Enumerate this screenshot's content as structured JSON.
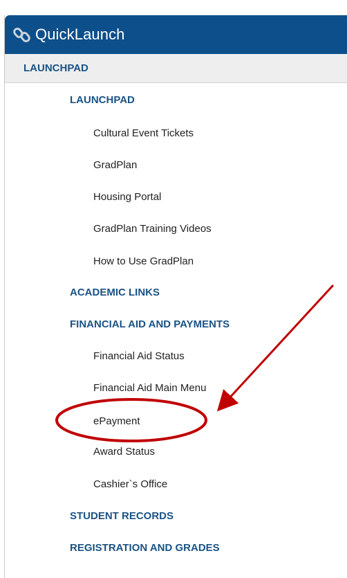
{
  "header": {
    "title": "QuickLaunch",
    "icon": "link-chain-icon",
    "bg_color": "#0d4f8b"
  },
  "section": {
    "label": "LAUNCHPAD"
  },
  "menu": [
    {
      "type": "category",
      "label": "LAUNCHPAD"
    },
    {
      "type": "item",
      "label": "Cultural Event Tickets"
    },
    {
      "type": "item",
      "label": "GradPlan"
    },
    {
      "type": "item",
      "label": "Housing Portal"
    },
    {
      "type": "item",
      "label": "GradPlan Training Videos"
    },
    {
      "type": "item",
      "label": "How to Use GradPlan"
    },
    {
      "type": "category",
      "label": "ACADEMIC LINKS"
    },
    {
      "type": "category",
      "label": "FINANCIAL AID AND PAYMENTS"
    },
    {
      "type": "item",
      "label": "Financial Aid Status"
    },
    {
      "type": "item",
      "label": "Financial Aid Main Menu"
    },
    {
      "type": "item",
      "label": "ePayment"
    },
    {
      "type": "item",
      "label": "Award Status"
    },
    {
      "type": "item",
      "label": "Cashier`s Office"
    },
    {
      "type": "category",
      "label": "STUDENT RECORDS"
    },
    {
      "type": "category",
      "label": "REGISTRATION AND GRADES"
    }
  ],
  "annotation": {
    "color": "#c00000",
    "highlighted": "ePayment"
  }
}
